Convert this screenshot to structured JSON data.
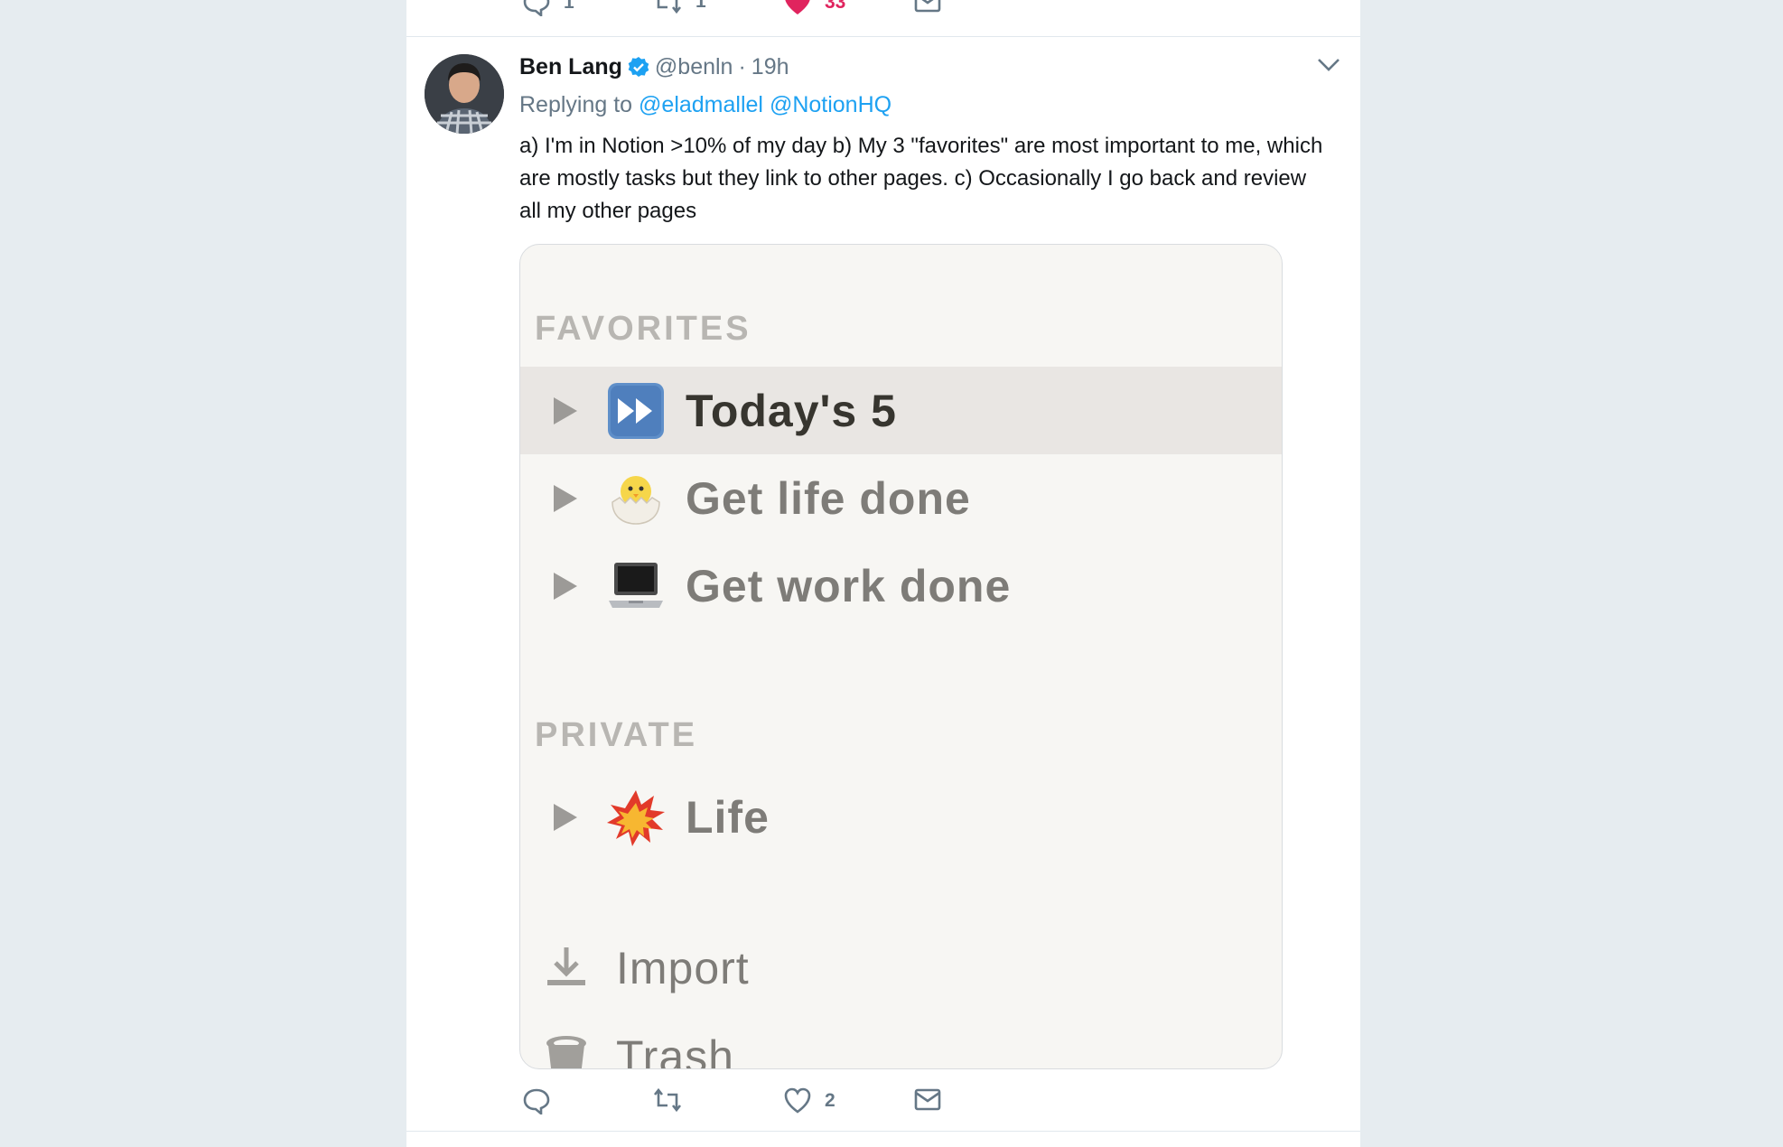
{
  "previous_tweet": {
    "reply_count": "1",
    "retweet_count": "1",
    "like_count": "33"
  },
  "tweet": {
    "name": "Ben Lang",
    "handle": "@benln",
    "separator": "·",
    "time": "19h",
    "replying_prefix": "Replying to",
    "mentions": [
      "@eladmallel",
      "@NotionHQ"
    ],
    "text": "a) I'm in Notion >10% of my day b) My 3 \"favorites\" are most important to me, which are mostly tasks but they link to other pages. c) Occasionally I go back and review all my other pages",
    "like_count": "2"
  },
  "notion_sidebar": {
    "favorites_header": "FAVORITES",
    "favorites": [
      {
        "label": "Today's 5",
        "icon": "fast-forward-icon"
      },
      {
        "label": "Get life done",
        "icon": "hatching-chick-icon"
      },
      {
        "label": "Get work done",
        "icon": "laptop-icon"
      }
    ],
    "private_header": "PRIVATE",
    "private": [
      {
        "label": "Life",
        "icon": "collision-icon"
      }
    ],
    "import_label": "Import",
    "trash_label": "Trash"
  },
  "colors": {
    "accent": "#1da1f2",
    "like": "#e0245e",
    "muted": "#657786",
    "background": "#e6ecf0"
  }
}
